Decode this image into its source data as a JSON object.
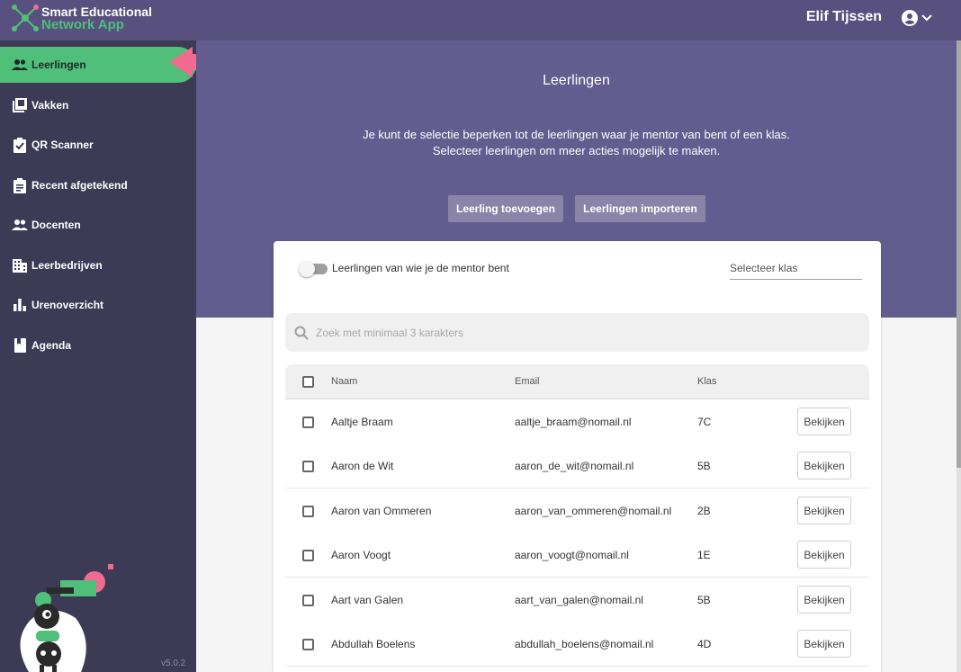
{
  "app": {
    "logo_line1": "Smart Educational",
    "logo_line2": "Network App",
    "version": "v5.0.2"
  },
  "user": {
    "name": "Elif Tijssen"
  },
  "sidebar": {
    "items": [
      {
        "label": "Leerlingen",
        "icon": "people-icon",
        "active": true
      },
      {
        "label": "Vakken",
        "icon": "book-icon"
      },
      {
        "label": "QR Scanner",
        "icon": "clipboard-check-icon"
      },
      {
        "label": "Recent afgetekend",
        "icon": "clipboard-list-icon"
      },
      {
        "label": "Docenten",
        "icon": "people-icon"
      },
      {
        "label": "Leerbedrijven",
        "icon": "building-icon"
      },
      {
        "label": "Urenoverzicht",
        "icon": "bar-chart-icon"
      },
      {
        "label": "Agenda",
        "icon": "bookmark-book-icon"
      }
    ]
  },
  "hero": {
    "title": "Leerlingen",
    "desc_line1": "Je kunt de selectie beperken tot de leerlingen waar je mentor van bent of een klas.",
    "desc_line2": "Selecteer leerlingen om meer acties mogelijk te maken.",
    "btn_add": "Leerling toevoegen",
    "btn_import": "Leerlingen importeren"
  },
  "filters": {
    "mentor_toggle_label": "Leerlingen van wie je de mentor bent",
    "mentor_toggle_on": false,
    "klas_placeholder": "Selecteer klas"
  },
  "search": {
    "placeholder": "Zoek met minimaal 3 karakters"
  },
  "table": {
    "headers": {
      "name": "Naam",
      "email": "Email",
      "klas": "Klas"
    },
    "view_label": "Bekijken",
    "rows": [
      {
        "name": "Aaltje Braam",
        "email": "aaltje_braam@nomail.nl",
        "klas": "7C"
      },
      {
        "name": "Aaron de Wit",
        "email": "aaron_de_wit@nomail.nl",
        "klas": "5B"
      },
      {
        "name": "Aaron van Ommeren",
        "email": "aaron_van_ommeren@nomail.nl",
        "klas": "2B"
      },
      {
        "name": "Aaron Voogt",
        "email": "aaron_voogt@nomail.nl",
        "klas": "1E"
      },
      {
        "name": "Aart van Galen",
        "email": "aart_van_galen@nomail.nl",
        "klas": "5B"
      },
      {
        "name": "Abdullah Boelens",
        "email": "abdullah_boelens@nomail.nl",
        "klas": "4D"
      }
    ]
  },
  "colors": {
    "topbar": "#58507e",
    "sidebar": "#3c3a55",
    "hero": "#635c8e",
    "accent_green": "#4fbf7a",
    "arrow_pink": "#f06b8f"
  }
}
